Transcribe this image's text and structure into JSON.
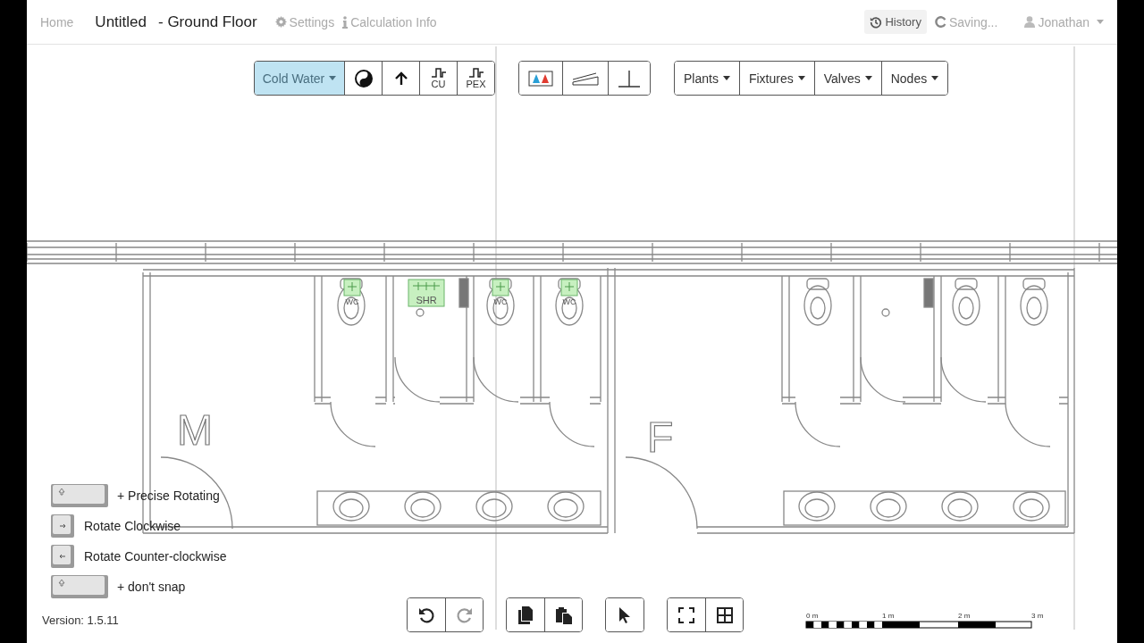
{
  "header": {
    "home": "Home",
    "title": "Untitled",
    "floor": "- Ground Floor",
    "links": [
      {
        "kind": "gear",
        "label": "Settings"
      },
      {
        "kind": "info",
        "label": "Calculation Info"
      }
    ],
    "history": "History",
    "status": "Saving...",
    "user": "Jonathan"
  },
  "toolbar": {
    "system": {
      "label": "Cold Water",
      "selected": true
    },
    "tools": [
      {
        "kind": "contrast"
      },
      {
        "kind": "arrow"
      },
      {
        "kind": "pipe",
        "label": "CU"
      },
      {
        "kind": "pipe",
        "label": "PEX"
      }
    ],
    "menus": [
      "Plants",
      "Fixtures",
      "Valves",
      "Nodes"
    ]
  },
  "plan": {
    "room_labels": [
      "M",
      "F"
    ],
    "fixtures": [
      {
        "kind": "wc",
        "label": "WC"
      },
      {
        "kind": "shower",
        "label": "SHR"
      },
      {
        "kind": "wc",
        "label": "WC"
      },
      {
        "kind": "wc",
        "label": "WC"
      }
    ]
  },
  "legend": [
    {
      "kind": "shift",
      "text": "+ Precise Rotating"
    },
    {
      "kind": "right",
      "text": "Rotate Clockwise"
    },
    {
      "kind": "left",
      "text": "Rotate Counter-clockwise"
    },
    {
      "kind": "shift",
      "text": "+ don't snap"
    }
  ],
  "version": "Version: 1.5.11",
  "bottom": {
    "history": [
      {
        "disabled": false
      },
      {
        "disabled": true
      }
    ]
  },
  "scale": [
    "0 m",
    "1 m",
    "2 m",
    "3 m"
  ]
}
